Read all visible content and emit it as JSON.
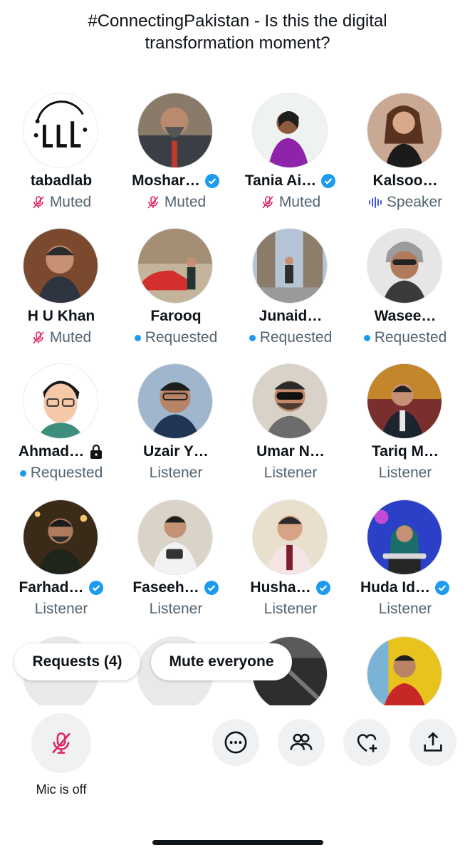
{
  "title": "#ConnectingPakistan - Is this the digital transformation moment?",
  "colors": {
    "accent": "#1d9bf0",
    "muted_icon": "#e0245e",
    "text_secondary": "#536471"
  },
  "participants": [
    {
      "name": "tabadlab",
      "status": "Muted",
      "status_icon": "mic-off-icon",
      "verified": false
    },
    {
      "name": "Moshar…",
      "status": "Muted",
      "status_icon": "mic-off-icon",
      "verified": true
    },
    {
      "name": "Tania Ai…",
      "status": "Muted",
      "status_icon": "mic-off-icon",
      "verified": true
    },
    {
      "name": "Kalsoo…",
      "status": "Speaker",
      "status_icon": "audio-wave-icon",
      "verified": false
    },
    {
      "name": "H U Khan",
      "status": "Muted",
      "status_icon": "mic-off-icon",
      "verified": false
    },
    {
      "name": "Farooq",
      "status": "Requested",
      "status_icon": "dot-icon",
      "verified": false
    },
    {
      "name": "Junaid…",
      "status": "Requested",
      "status_icon": "dot-icon",
      "verified": false
    },
    {
      "name": "Wasee…",
      "status": "Requested",
      "status_icon": "dot-icon",
      "verified": false
    },
    {
      "name": "Ahmad…",
      "status": "Requested",
      "status_icon": "dot-icon",
      "verified": false,
      "locked": true
    },
    {
      "name": "Uzair Y…",
      "status": "Listener",
      "status_icon": "",
      "verified": false
    },
    {
      "name": "Umar N…",
      "status": "Listener",
      "status_icon": "",
      "verified": false
    },
    {
      "name": "Tariq M…",
      "status": "Listener",
      "status_icon": "",
      "verified": false
    },
    {
      "name": "Farhad…",
      "status": "Listener",
      "status_icon": "",
      "verified": true
    },
    {
      "name": "Faseeh…",
      "status": "Listener",
      "status_icon": "",
      "verified": true
    },
    {
      "name": "Husha…",
      "status": "Listener",
      "status_icon": "",
      "verified": true
    },
    {
      "name": "Huda Id…",
      "status": "Listener",
      "status_icon": "",
      "verified": true
    }
  ],
  "actions": {
    "requests_label": "Requests (4)",
    "mute_everyone_label": "Mute everyone"
  },
  "bottom_bar": {
    "mic_label": "Mic is off",
    "buttons": [
      "more-icon",
      "people-icon",
      "heart-plus-icon",
      "share-icon"
    ]
  }
}
